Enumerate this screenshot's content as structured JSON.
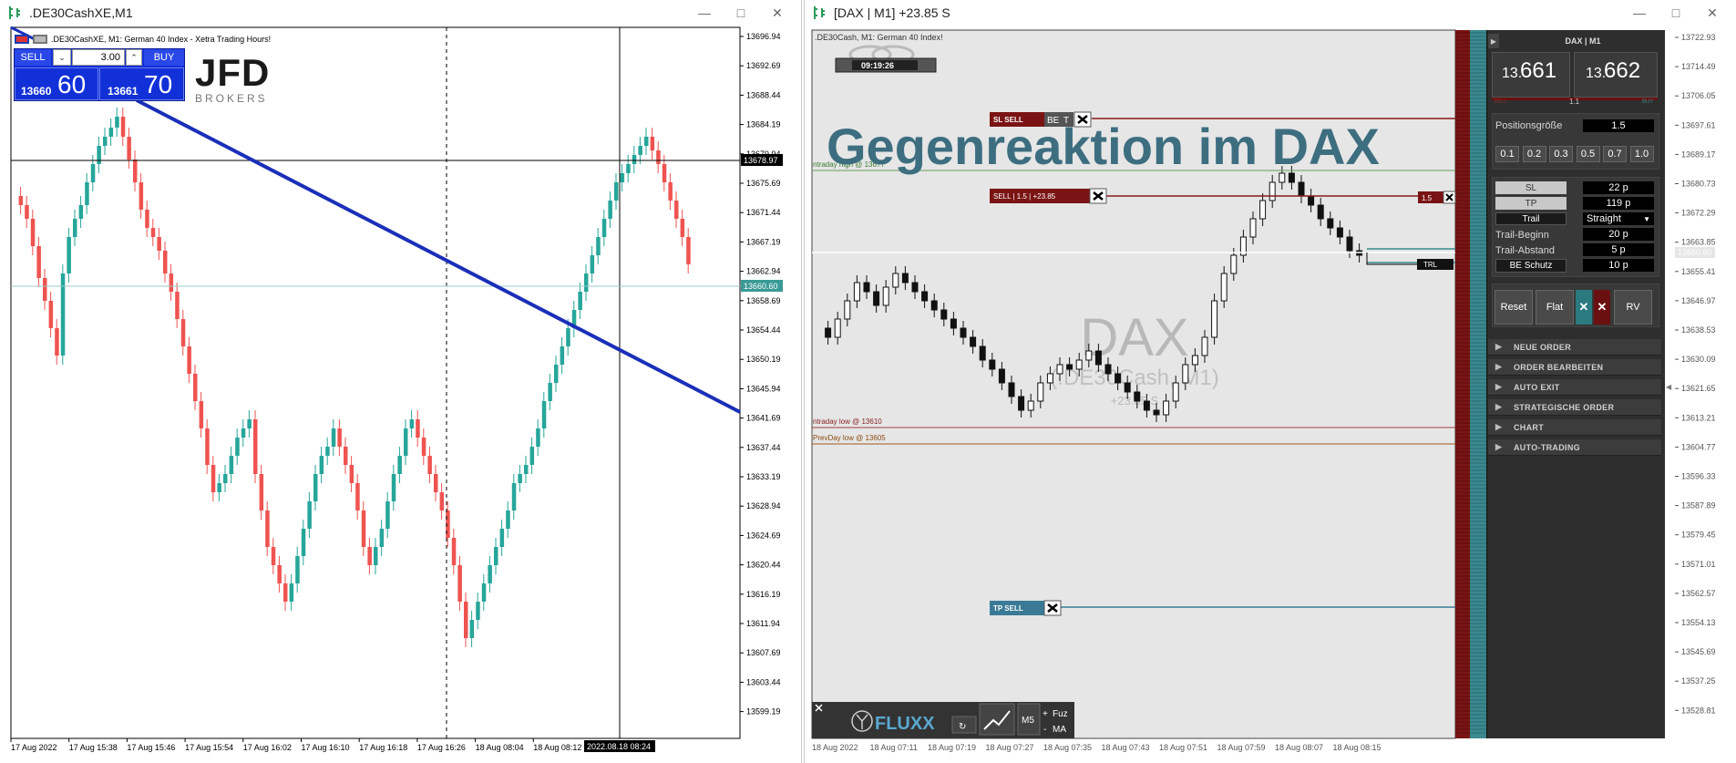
{
  "left_window": {
    "title": ".DE30CashXE,M1",
    "chart_header": ".DE30CashXE, M1:  German 40 Index  - Xetra Trading Hours!",
    "trade_panel": {
      "sell_label": "SELL",
      "buy_label": "BUY",
      "volume": "3.00",
      "sell_price_small": "13660",
      "sell_price_big": "60",
      "buy_price_small": "13661",
      "buy_price_big": "70"
    },
    "broker_logo": "JFD",
    "broker_sub": "BROKERS",
    "price_axis": [
      "13696.94",
      "13692.69",
      "13688.44",
      "13684.19",
      "13679.94",
      "13675.69",
      "13671.44",
      "13667.19",
      "13662.94",
      "13658.69",
      "13654.44",
      "13650.19",
      "13645.94",
      "13641.69",
      "13637.44",
      "13633.19",
      "13628.94",
      "13624.69",
      "13620.44",
      "13616.19",
      "13611.94",
      "13607.69",
      "13603.44",
      "13599.19"
    ],
    "crosshair_price": "13678.97",
    "bid_price_tag": "13660.60",
    "time_axis": [
      "17 Aug 2022",
      "17 Aug 15:38",
      "17 Aug 15:46",
      "17 Aug 15:54",
      "17 Aug 16:02",
      "17 Aug 16:10",
      "17 Aug 16:18",
      "17 Aug 16:26",
      "18 Aug 08:04",
      "18 Aug 08:12"
    ],
    "crosshair_time": "2022.08.18 08:24"
  },
  "right_window": {
    "title": "[DAX | M1] +23.85 S",
    "chart_header": ".DE30Cash, M1:  German 40 Index!",
    "timer": "09:19:26",
    "headline": "Gegenreaktion im DAX",
    "watermark_symbol": "DAX",
    "watermark_sub": "(.DE30Cash, M1)",
    "watermark_pnl": "+23.85 S",
    "lines": {
      "sl_label": "SL SELL",
      "be_label": "BE",
      "t_label": "T",
      "sell_label": "SELL | 1.5 | +23.85",
      "intraday_high": "ntraday high @ 13677",
      "intraday_low": "ntraday low @ 13610",
      "prevday_low": "PrevDay low @ 13605",
      "tp_label": "TP SELL",
      "trl_label": "TRL",
      "lot_tag": "1.5"
    },
    "price_axis": [
      "13722.93",
      "13714.49",
      "13706.05",
      "13697.61",
      "13689.17",
      "13680.73",
      "13672.29",
      "13663.85",
      "13655.41",
      "13646.97",
      "13638.53",
      "13630.09",
      "13621.65",
      "13613.21",
      "13604.77",
      "13596.33",
      "13587.89",
      "13579.45",
      "13571.01",
      "13562.57",
      "13554.13",
      "13545.69",
      "13537.25",
      "13528.81"
    ],
    "bid_price_tag": "13660.60",
    "time_axis": [
      "18 Aug 2022",
      "18 Aug 07:11",
      "18 Aug 07:19",
      "18 Aug 07:27",
      "18 Aug 07:35",
      "18 Aug 07:43",
      "18 Aug 07:51",
      "18 Aug 07:59",
      "18 Aug 08:07",
      "18 Aug 08:15"
    ],
    "toolbar": {
      "brand": "FLUXX",
      "m5": "M5",
      "fuz": "Fuz",
      "ma": "MA",
      "plus": "+",
      "minus": "-"
    }
  },
  "side_panel": {
    "header": "DAX | M1",
    "bid_small": "13.",
    "bid_big": "661",
    "ask_small": "13.",
    "ask_big": "662",
    "spread": "1.1",
    "sell_hint": "SELL",
    "buy_hint": "BUY",
    "position_size_label": "Positionsgröße",
    "position_size_value": "1.5",
    "quick_sizes": [
      "0.1",
      "0.2",
      "0.3",
      "0.5",
      "0.7",
      "1.0"
    ],
    "sl_label": "SL",
    "sl_value": "22 p",
    "tp_label": "TP",
    "tp_value": "119 p",
    "trail_label": "Trail",
    "trail_value": "Straight",
    "trail_begin_label": "Trail-Beginn",
    "trail_begin_value": "20 p",
    "trail_dist_label": "Trail-Abstand",
    "trail_dist_value": "5 p",
    "be_label": "BE Schutz",
    "be_value": "10 p",
    "reset": "Reset",
    "flat": "Flat",
    "rv": "RV",
    "sections": [
      "NEUE ORDER",
      "ORDER BEARBEITEN",
      "AUTO EXIT",
      "STRATEGISCHE ORDER",
      "CHART",
      "AUTO-TRADING"
    ]
  },
  "colors": {
    "bull": "#26a69a",
    "bear": "#ef5350",
    "trendline": "#1a2fb8",
    "headline": "#3d6e80",
    "sell_blue": "#1230d8",
    "dark_red": "#7a1414",
    "teal": "#3a8a90"
  }
}
